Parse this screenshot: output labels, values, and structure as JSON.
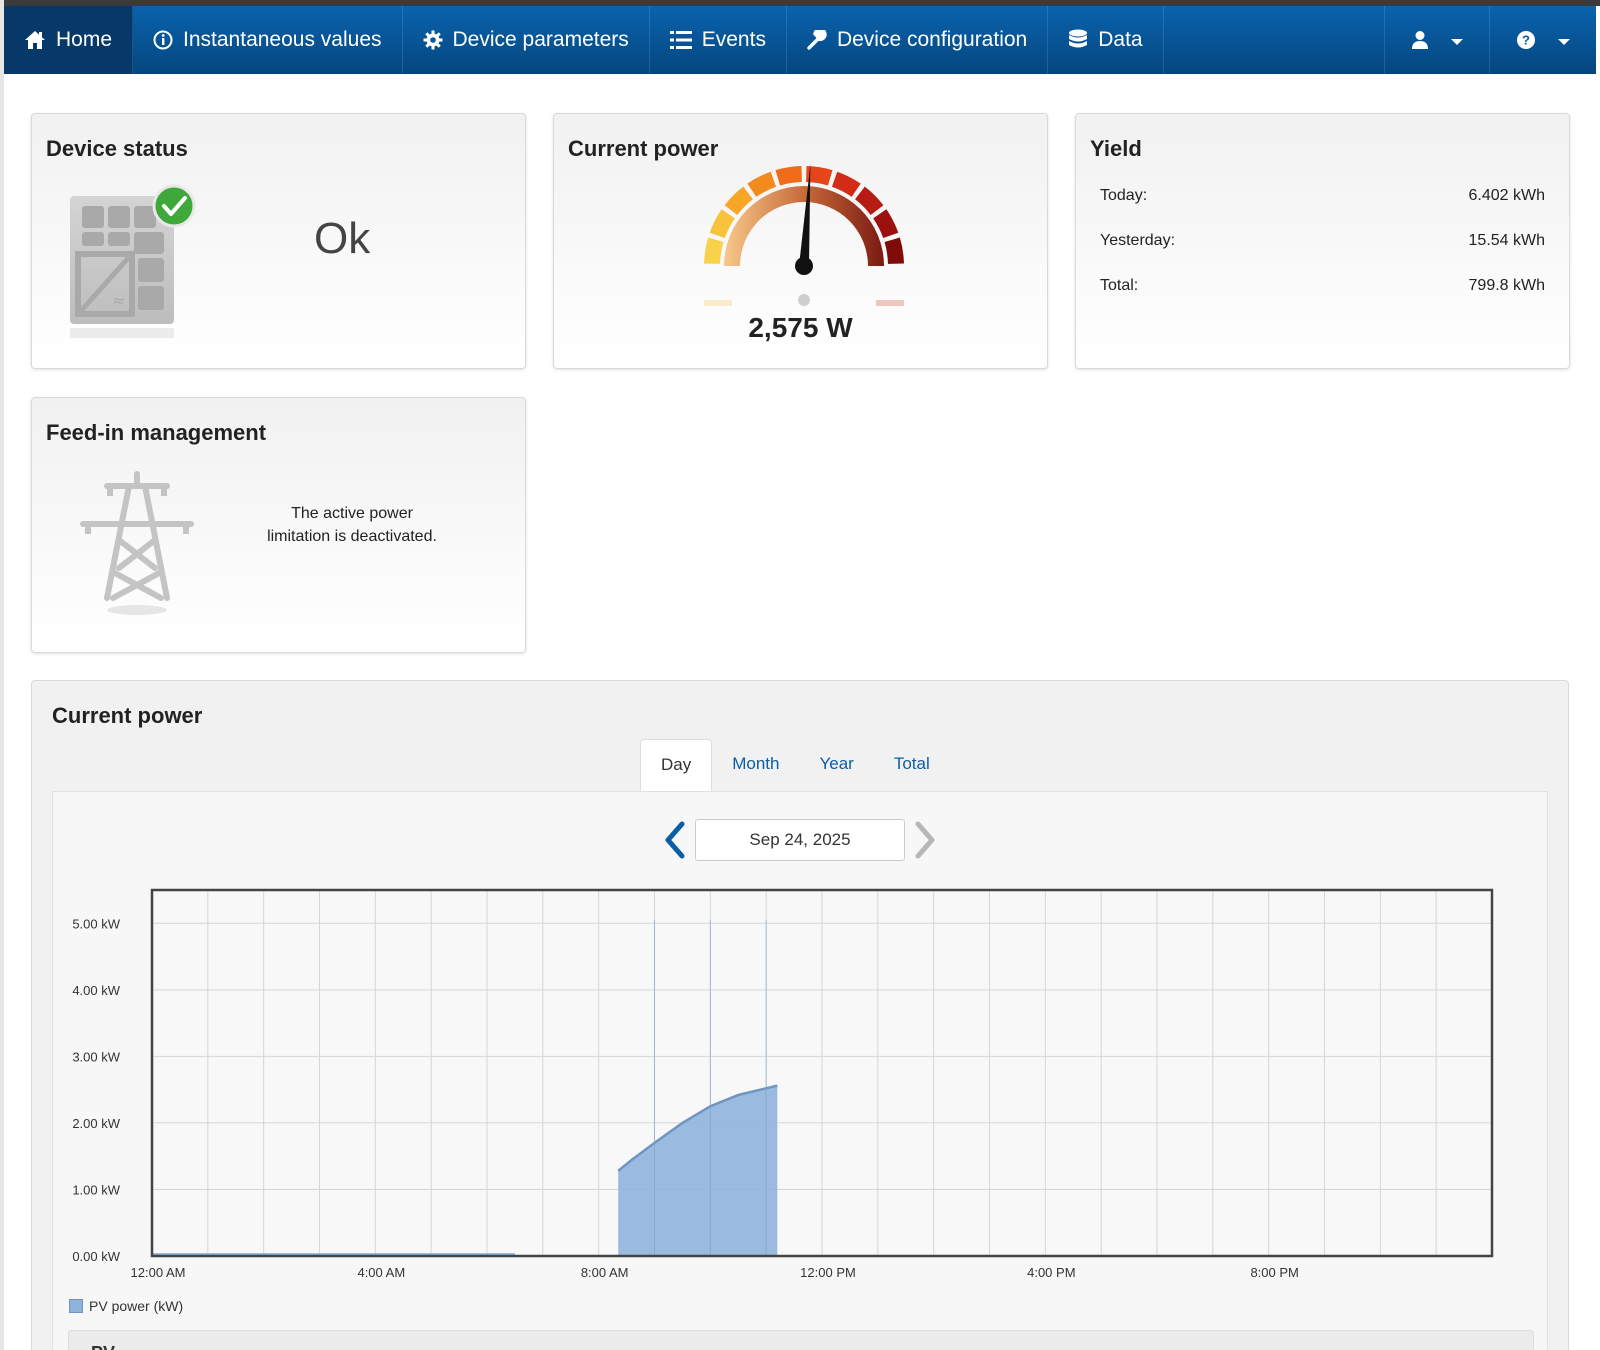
{
  "nav": {
    "items": [
      {
        "label": "Home",
        "icon": "home-icon",
        "active": true
      },
      {
        "label": "Instantaneous values",
        "icon": "info-circle-icon"
      },
      {
        "label": "Device parameters",
        "icon": "gear-icon"
      },
      {
        "label": "Events",
        "icon": "list-icon"
      },
      {
        "label": "Device configuration",
        "icon": "wrench-icon"
      },
      {
        "label": "Data",
        "icon": "database-icon"
      }
    ],
    "user_icon": "user-icon",
    "help_icon": "help-icon"
  },
  "device_status": {
    "title": "Device status",
    "status": "Ok"
  },
  "current_power_card": {
    "title": "Current power",
    "value": "2,575 W",
    "gauge_fraction": 0.52
  },
  "yield": {
    "title": "Yield",
    "rows": [
      {
        "label": "Today:",
        "value": "6.402 kWh"
      },
      {
        "label": "Yesterday:",
        "value": "15.54 kWh"
      },
      {
        "label": "Total:",
        "value": "799.8 kWh"
      }
    ]
  },
  "feed_in": {
    "title": "Feed-in management",
    "line1": "The active power",
    "line2": "limitation is deactivated."
  },
  "chart_panel": {
    "title": "Current power",
    "tabs": [
      "Day",
      "Month",
      "Year",
      "Total"
    ],
    "active_tab": "Day",
    "date": "Sep 24, 2025",
    "subpanel_label": "PV"
  },
  "chart_data": {
    "type": "area",
    "series": [
      {
        "name": "PV power (kW)",
        "x": [
          0,
          1,
          2,
          3,
          4,
          5,
          6,
          6.5,
          8.35,
          8.6,
          9,
          9.5,
          10,
          10.5,
          11,
          11.2
        ],
        "values": [
          0.02,
          0.02,
          0.02,
          0.02,
          0.02,
          0.02,
          0.02,
          0.02,
          1.28,
          1.45,
          1.7,
          2.0,
          2.25,
          2.42,
          2.52,
          2.56
        ]
      }
    ],
    "x_ticks": [
      "12:00 AM",
      "4:00 AM",
      "8:00 AM",
      "12:00 PM",
      "4:00 PM",
      "8:00 PM"
    ],
    "y_ticks": [
      "0.00 kW",
      "1.00 kW",
      "2.00 kW",
      "3.00 kW",
      "4.00 kW",
      "5.00 kW"
    ],
    "xlim": [
      0,
      24
    ],
    "ylim": [
      0,
      5.5
    ],
    "grid": true,
    "legend": "bottom-left",
    "color": "#8fb4dc"
  }
}
